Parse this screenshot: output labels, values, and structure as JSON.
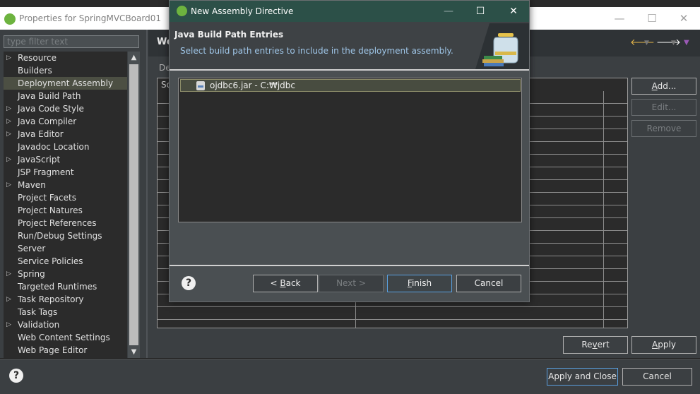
{
  "properties_window": {
    "title": "Properties for SpringMVCBoard01",
    "filter_placeholder": "type filter text",
    "page_title": "We",
    "deployment_label": "De",
    "grid_header_fragment": "So",
    "tree_items": [
      {
        "label": "Resource",
        "expandable": true
      },
      {
        "label": "Builders",
        "expandable": false
      },
      {
        "label": "Deployment Assembly",
        "expandable": false,
        "selected": true
      },
      {
        "label": "Java Build Path",
        "expandable": false
      },
      {
        "label": "Java Code Style",
        "expandable": true
      },
      {
        "label": "Java Compiler",
        "expandable": true
      },
      {
        "label": "Java Editor",
        "expandable": true
      },
      {
        "label": "Javadoc Location",
        "expandable": false
      },
      {
        "label": "JavaScript",
        "expandable": true
      },
      {
        "label": "JSP Fragment",
        "expandable": false
      },
      {
        "label": "Maven",
        "expandable": true
      },
      {
        "label": "Project Facets",
        "expandable": false
      },
      {
        "label": "Project Natures",
        "expandable": false
      },
      {
        "label": "Project References",
        "expandable": false
      },
      {
        "label": "Run/Debug Settings",
        "expandable": false
      },
      {
        "label": "Server",
        "expandable": false
      },
      {
        "label": "Service Policies",
        "expandable": false
      },
      {
        "label": "Spring",
        "expandable": true
      },
      {
        "label": "Targeted Runtimes",
        "expandable": false
      },
      {
        "label": "Task Repository",
        "expandable": true
      },
      {
        "label": "Task Tags",
        "expandable": false
      },
      {
        "label": "Validation",
        "expandable": true
      },
      {
        "label": "Web Content Settings",
        "expandable": false
      },
      {
        "label": "Web Page Editor",
        "expandable": false
      }
    ],
    "side_buttons": {
      "add": "Add...",
      "edit": "Edit...",
      "remove": "Remove"
    },
    "revert": "Revert",
    "apply": "Apply",
    "apply_and_close": "Apply and Close",
    "cancel": "Cancel"
  },
  "dialog": {
    "title": "New Assembly Directive",
    "banner_title": "Java Build Path Entries",
    "banner_subtitle": "Select build path entries to include in the deployment assembly.",
    "entries": [
      {
        "label": "ojdbc6.jar - C:₩jdbc",
        "checked": false
      }
    ],
    "buttons": {
      "back": "< Back",
      "next": "Next >",
      "finish": "Finish",
      "cancel": "Cancel"
    },
    "help": "?"
  },
  "icons": {
    "app_logo": "spring-leaf-icon",
    "tree_twisty": "expand-triangle-icon",
    "jar": "jar-file-icon",
    "help": "help-icon",
    "nav_back": "back-arrow-icon",
    "nav_forward": "forward-arrow-icon"
  },
  "colors": {
    "dialog_title_bar": "#2c5048",
    "banner_subtitle": "#9fc6e8",
    "spring_green": "#6db33f",
    "nav_arrow": "#e8b84a"
  }
}
